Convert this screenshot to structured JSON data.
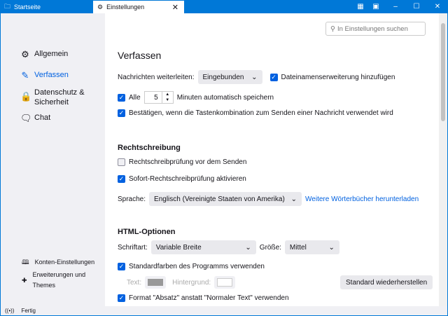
{
  "tabs": [
    {
      "label": "Startseite",
      "icon": "folder-icon"
    },
    {
      "label": "Einstellungen",
      "icon": "gear-icon"
    }
  ],
  "window_controls": {
    "minimize": "–",
    "maximize": "☐",
    "close": "✕"
  },
  "search": {
    "placeholder": "In Einstellungen suchen"
  },
  "sidebar": {
    "items": [
      {
        "label": "Allgemein",
        "icon": "gear-icon"
      },
      {
        "label": "Verfassen",
        "icon": "pencil-icon",
        "selected": true
      },
      {
        "label": "Datenschutz & Sicherheit",
        "icon": "lock-icon"
      },
      {
        "label": "Chat",
        "icon": "chat-icon"
      }
    ],
    "footer": [
      {
        "label": "Konten-Einstellungen",
        "icon": "book-icon"
      },
      {
        "label": "Erweiterungen und Themes",
        "icon": "puzzle-icon"
      }
    ]
  },
  "main": {
    "title": "Verfassen",
    "forward_label": "Nachrichten weiterleiten:",
    "forward_value": "Eingebunden",
    "add_ext_label": "Dateinamenserweiterung hinzufügen",
    "add_ext_checked": true,
    "autosave_label": "Alle",
    "autosave_value": "5",
    "autosave_suffix": "Minuten automatisch speichern",
    "autosave_checked": true,
    "confirm_label": "Bestätigen, wenn die Tastenkombination zum Senden einer Nachricht verwendet wird",
    "confirm_checked": true,
    "spelling_title": "Rechtschreibung",
    "spell_before_send": "Rechtschreibprüfung vor dem Senden",
    "spell_before_send_checked": false,
    "spell_instant": "Sofort-Rechtschreibprüfung aktivieren",
    "spell_instant_checked": true,
    "language_label": "Sprache:",
    "language_value": "Englisch (Vereinigte Staaten von Amerika)",
    "dictionaries_link": "Weitere Wörterbücher herunterladen",
    "html_title": "HTML-Optionen",
    "font_label": "Schriftart:",
    "font_value": "Variable Breite",
    "size_label": "Größe:",
    "size_value": "Mittel",
    "default_colors": "Standardfarben des Programms verwenden",
    "default_colors_checked": true,
    "text_label": "Text:",
    "text_color": "#999999",
    "bg_label": "Hintergrund:",
    "bg_color": "#ffffff",
    "restore_button": "Standard wiederherstellen",
    "paragraph_format": "Format \"Absatz\" anstatt \"Normaler Text\" verwenden",
    "paragraph_checked": true
  },
  "status": {
    "text": "Fertig",
    "icon": "broadcast-icon"
  },
  "colors": {
    "accent": "#0061e0",
    "titlebar": "#0078d7",
    "sidebar": "#f0f0f4"
  }
}
